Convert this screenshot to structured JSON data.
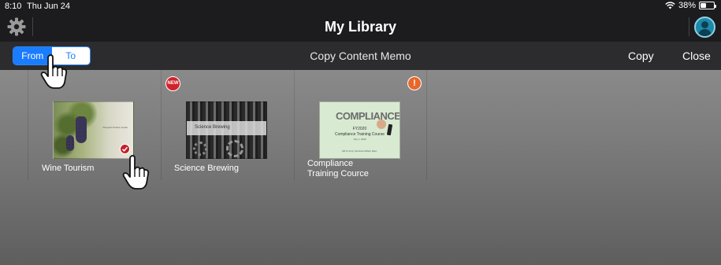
{
  "status_bar": {
    "time": "8:10",
    "date": "Thu Jun 24",
    "battery": "38%",
    "battery_level": 0.38,
    "wifi_icon": "wifi-icon"
  },
  "nav": {
    "title": "My Library",
    "settings_icon": "gear-icon",
    "profile_icon": "user-avatar-icon"
  },
  "toolbar": {
    "segments": [
      "From",
      "To"
    ],
    "selected_segment": "From",
    "memo_title": "Copy Content Memo",
    "copy_label": "Copy",
    "close_label": "Close"
  },
  "library": {
    "items": [
      {
        "title": "Wine Tourism",
        "selected": true,
        "badge": "check-icon",
        "thumbnail_caption": "Vineyard Tourism Guide"
      },
      {
        "title": "Science Brewing",
        "badge": "NEW",
        "thumbnail_caption": "Science Brewing"
      },
      {
        "title_line1": "Compliance",
        "title_line2": "Training Cource",
        "badge": "!",
        "thumbnail_heading": "COMPLIANCE",
        "thumbnail_line1": "FY2020",
        "thumbnail_line2": "Compliance Training Course",
        "thumbnail_line3": "July 1, 2020",
        "thumbnail_line4": "HR & Corp. Services Affairs Dept."
      }
    ]
  },
  "colors": {
    "accent": "#1a7cff",
    "new_badge": "#d0232b",
    "alert_badge": "#e8682b",
    "check_badge": "#c4202a"
  }
}
